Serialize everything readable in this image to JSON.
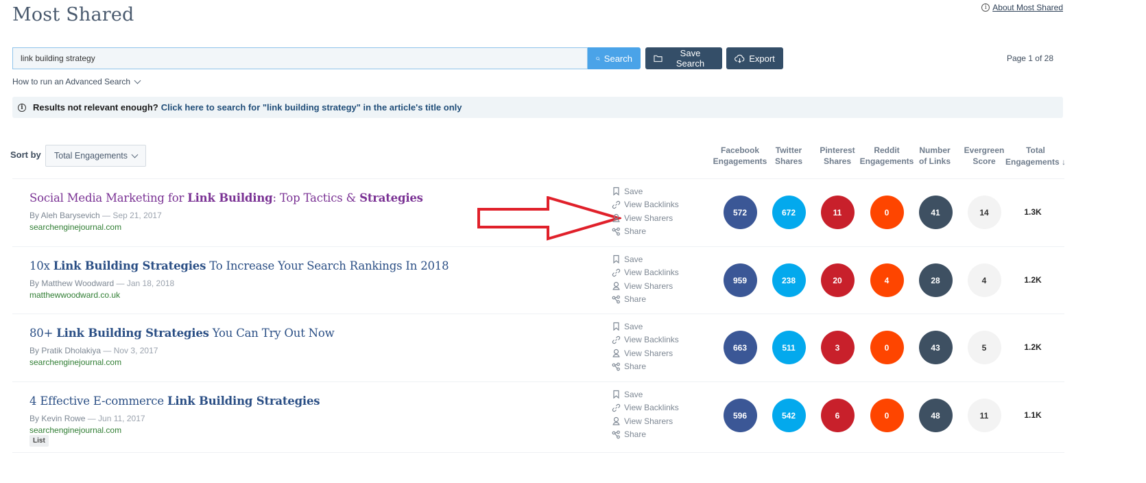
{
  "header": {
    "title": "Most Shared",
    "about_link": "About Most Shared",
    "page_indicator": "Page 1 of 28"
  },
  "search": {
    "value": "link building strategy",
    "search_button": "Search",
    "save_search_button": "Save Search",
    "export_button": "Export",
    "advanced_link": "How to run an Advanced Search"
  },
  "notice": {
    "question": "Results not relevant enough?",
    "link": "Click here to search for \"link building strategy\" in the article's title only"
  },
  "sort": {
    "label": "Sort by",
    "selected": "Total Engagements"
  },
  "columns": [
    {
      "line1": "Facebook",
      "line2": "Engagements"
    },
    {
      "line1": "Twitter",
      "line2": "Shares"
    },
    {
      "line1": "Pinterest",
      "line2": "Shares"
    },
    {
      "line1": "Reddit",
      "line2": "Engagements"
    },
    {
      "line1": "Number",
      "line2": "of Links"
    },
    {
      "line1": "Evergreen",
      "line2": "Score"
    },
    {
      "line1": "Total",
      "line2": "Engagements ↓"
    }
  ],
  "actions": {
    "save": "Save",
    "view_backlinks": "View Backlinks",
    "view_sharers": "View Sharers",
    "share": "Share"
  },
  "colors": {
    "facebook": "#3b5796",
    "twitter": "#03a9ed",
    "pinterest": "#c8202b",
    "reddit": "#fe4500",
    "links": "#3e5062",
    "evergreen": "#f3f3f3",
    "annotation_arrow": "#e0202a"
  },
  "results": [
    {
      "visited": true,
      "title_parts": [
        {
          "t": "Social Media Marketing for ",
          "b": false
        },
        {
          "t": "Link Building",
          "b": true
        },
        {
          "t": ": Top Tactics & ",
          "b": false
        },
        {
          "t": "Strategies",
          "b": true
        }
      ],
      "author": "By Aleh Barysevich",
      "date": "Sep 21, 2017",
      "domain": "searchenginejournal.com",
      "tag": null,
      "facebook": "572",
      "twitter": "672",
      "pinterest": "11",
      "reddit": "0",
      "links": "41",
      "evergreen": "14",
      "total": "1.3K"
    },
    {
      "visited": false,
      "title_parts": [
        {
          "t": "10x ",
          "b": false
        },
        {
          "t": "Link Building Strategies",
          "b": true
        },
        {
          "t": " To Increase Your Search Rankings In 2018",
          "b": false
        }
      ],
      "author": "By Matthew Woodward",
      "date": "Jan 18, 2018",
      "domain": "matthewwoodward.co.uk",
      "tag": null,
      "facebook": "959",
      "twitter": "238",
      "pinterest": "20",
      "reddit": "4",
      "links": "28",
      "evergreen": "4",
      "total": "1.2K"
    },
    {
      "visited": false,
      "title_parts": [
        {
          "t": "80+ ",
          "b": false
        },
        {
          "t": "Link Building Strategies",
          "b": true
        },
        {
          "t": " You Can Try Out Now",
          "b": false
        }
      ],
      "author": "By Pratik Dholakiya",
      "date": "Nov 3, 2017",
      "domain": "searchenginejournal.com",
      "tag": null,
      "facebook": "663",
      "twitter": "511",
      "pinterest": "3",
      "reddit": "0",
      "links": "43",
      "evergreen": "5",
      "total": "1.2K"
    },
    {
      "visited": false,
      "title_parts": [
        {
          "t": "4 Effective E-commerce ",
          "b": false
        },
        {
          "t": "Link Building Strategies",
          "b": true
        }
      ],
      "author": "By Kevin Rowe",
      "date": "Jun 11, 2017",
      "domain": "searchenginejournal.com",
      "tag": "List",
      "facebook": "596",
      "twitter": "542",
      "pinterest": "6",
      "reddit": "0",
      "links": "48",
      "evergreen": "11",
      "total": "1.1K"
    }
  ]
}
